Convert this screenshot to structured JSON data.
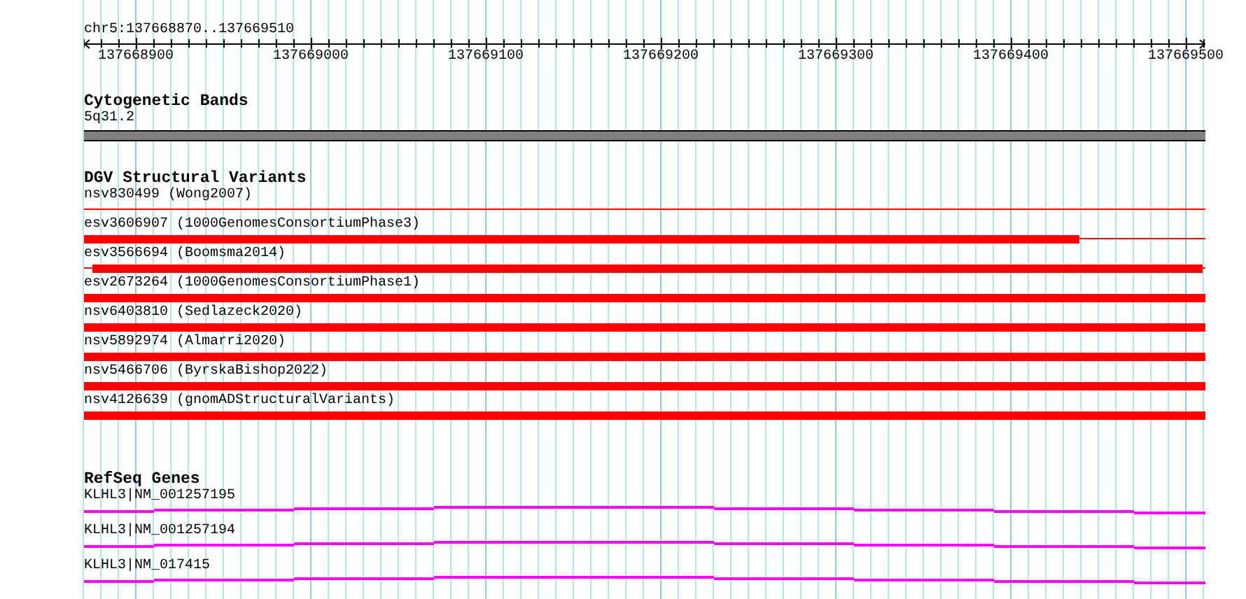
{
  "ruler": {
    "location": "chr5:137668870..137669510",
    "ticks": [
      "137668900",
      "137669000",
      "137669100",
      "137669200",
      "137669300",
      "137669400",
      "137669500"
    ]
  },
  "tracks": [
    {
      "kind": "cytoband",
      "title": "Cytogenetic Bands",
      "features": [
        {
          "label": "5q31.2"
        }
      ]
    },
    {
      "kind": "variants",
      "title": "DGV Structural Variants",
      "features": [
        {
          "label": "nsv830499 (Wong2007)",
          "kind": "line"
        },
        {
          "label": "esv3606907 (1000GenomesConsortiumPhase3)",
          "kind": "bar_then_line"
        },
        {
          "label": "esv3566694 (Boomsma2014)",
          "kind": "inset_bar"
        },
        {
          "label": "esv2673264 (1000GenomesConsortiumPhase1)",
          "kind": "bar"
        },
        {
          "label": "nsv6403810 (Sedlazeck2020)",
          "kind": "bar"
        },
        {
          "label": "nsv5892974 (Almarri2020)",
          "kind": "bar"
        },
        {
          "label": "nsv5466706 (ByrskaBishop2022)",
          "kind": "bar"
        },
        {
          "label": "nsv4126639 (gnomADStructuralVariants)",
          "kind": "bar"
        }
      ]
    },
    {
      "kind": "genes",
      "title": "RefSeq Genes",
      "features": [
        {
          "label": "KLHL3|NM_001257195"
        },
        {
          "label": "KLHL3|NM_001257194"
        },
        {
          "label": "KLHL3|NM_017415"
        }
      ]
    }
  ]
}
